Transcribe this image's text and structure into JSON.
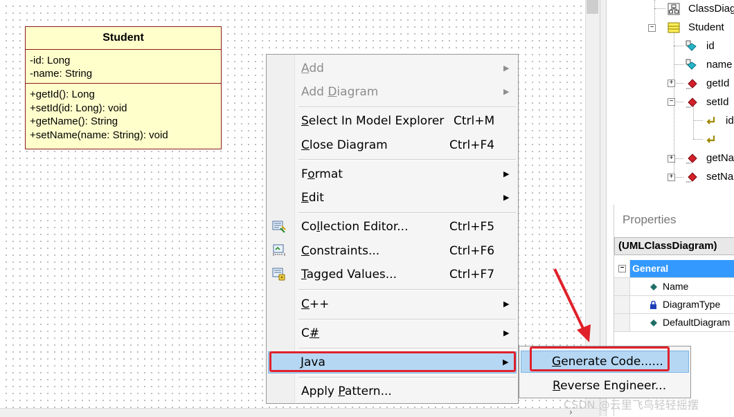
{
  "uml_class": {
    "name": "Student",
    "attributes": [
      "-id: Long",
      "-name: String"
    ],
    "operations": [
      "+getId(): Long",
      "+setId(id: Long): void",
      "+getName(): String",
      "+setName(name: String): void"
    ]
  },
  "model_tree": {
    "items": [
      {
        "label": "ClassDiag",
        "icon": "class-diagram-icon"
      },
      {
        "label": "Student",
        "icon": "class-icon",
        "toggle": "−"
      },
      {
        "label": "id",
        "icon": "attribute-icon"
      },
      {
        "label": "name",
        "icon": "attribute-icon"
      },
      {
        "label": "getId",
        "icon": "operation-icon",
        "toggle": "+"
      },
      {
        "label": "setId",
        "icon": "operation-icon",
        "toggle": "−"
      },
      {
        "label": "id",
        "icon": "parameter-icon"
      },
      {
        "label": "",
        "icon": "return-parameter-icon"
      },
      {
        "label": "getNa",
        "icon": "operation-icon",
        "toggle": "+"
      },
      {
        "label": "setNa",
        "icon": "operation-icon",
        "toggle": "+"
      }
    ]
  },
  "properties": {
    "title": "Properties",
    "header": "(UMLClassDiagram)",
    "group": "General",
    "rows": [
      {
        "label": "Name",
        "icon": "diamond-icon"
      },
      {
        "label": "DiagramType",
        "icon": "lock-icon"
      },
      {
        "label": "DefaultDiagram",
        "icon": "diamond-icon"
      }
    ],
    "group_toggle": "−"
  },
  "context_menu": {
    "add": {
      "prefix": "",
      "key": "A",
      "rest": "dd"
    },
    "add_diagram": {
      "prefix": "Add ",
      "key": "D",
      "rest": "iagram"
    },
    "select_in_model_explorer": {
      "prefix": "",
      "key": "S",
      "rest": "elect In Model Explorer",
      "shortcut": "Ctrl+M"
    },
    "close_diagram": {
      "prefix": "",
      "key": "C",
      "rest": "lose Diagram",
      "shortcut": "Ctrl+F4"
    },
    "format": {
      "prefix": "F",
      "key": "o",
      "rest": "rmat"
    },
    "edit": {
      "prefix": "",
      "key": "E",
      "rest": "dit"
    },
    "collection_editor": {
      "prefix": "Co",
      "key": "l",
      "rest": "lection Editor...",
      "shortcut": "Ctrl+F5"
    },
    "constraints": {
      "prefix": "",
      "key": "C",
      "rest": "onstraints...",
      "shortcut": "Ctrl+F6"
    },
    "tagged_values": {
      "prefix": "",
      "key": "T",
      "rest": "agged Values...",
      "shortcut": "Ctrl+F7"
    },
    "cpp": {
      "prefix": "",
      "key": "C",
      "rest": "++"
    },
    "csharp": {
      "prefix": "C",
      "key": "#",
      "rest": ""
    },
    "java": {
      "prefix": "",
      "key": "J",
      "rest": "ava"
    },
    "apply_pattern": {
      "prefix": "Apply ",
      "key": "P",
      "rest": "attern..."
    }
  },
  "java_submenu": {
    "generate_code": {
      "prefix": "",
      "key": "G",
      "rest": "enerate Code......"
    },
    "reverse_engineer": {
      "prefix": "",
      "key": "R",
      "rest": "everse Engineer..."
    }
  },
  "watermark": "CSDN @云里飞鸟轻轻摇摆",
  "colors": {
    "highlight_box": "#e0202a",
    "selection": "#b5d7f3",
    "class_fill": "#ffffcc",
    "class_border": "#8b1a1a"
  }
}
